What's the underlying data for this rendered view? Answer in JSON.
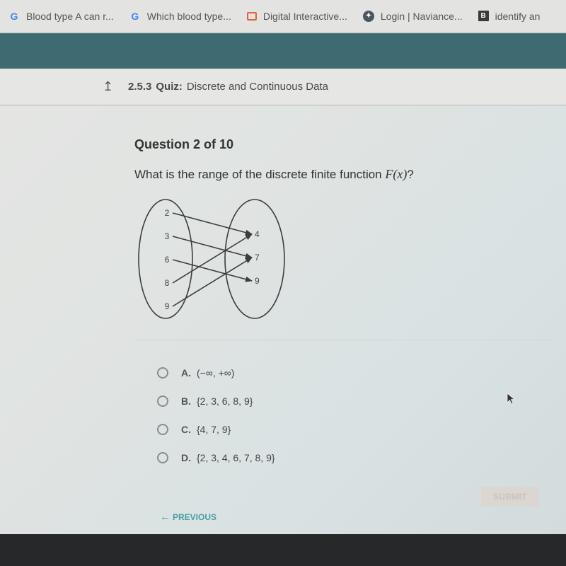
{
  "bookmarks": [
    {
      "icon": "google-icon",
      "glyph": "G",
      "label": "Blood type A can r..."
    },
    {
      "icon": "google-icon",
      "glyph": "G",
      "label": "Which blood type..."
    },
    {
      "icon": "digital-interactive-icon",
      "glyph": "",
      "label": "Digital Interactive..."
    },
    {
      "icon": "naviance-icon",
      "glyph": "✦",
      "label": "Login | Naviance..."
    },
    {
      "icon": "brainly-icon",
      "glyph": "B",
      "label": "identify an"
    }
  ],
  "quiz": {
    "up_icon": "↥",
    "code": "2.5.3",
    "kind": "Quiz:",
    "title": "Discrete and Continuous Data"
  },
  "question": {
    "number": "Question 2 of 10",
    "text_prefix": "What is the range of the discrete finite function ",
    "function": "F(x)",
    "text_suffix": "?"
  },
  "mapping": {
    "domain": [
      "2",
      "3",
      "6",
      "8",
      "9"
    ],
    "range": [
      "4",
      "7",
      "9"
    ],
    "arrows": [
      {
        "from": "2",
        "to": "4"
      },
      {
        "from": "3",
        "to": "7"
      },
      {
        "from": "6",
        "to": "9"
      },
      {
        "from": "8",
        "to": "4"
      },
      {
        "from": "9",
        "to": "7"
      }
    ]
  },
  "options": [
    {
      "letter": "A.",
      "value": "(−∞, +∞)",
      "selected": false
    },
    {
      "letter": "B.",
      "value": "{2, 3, 6, 8, 9}",
      "selected": false
    },
    {
      "letter": "C.",
      "value": "{4, 7, 9}",
      "selected": false
    },
    {
      "letter": "D.",
      "value": "{2, 3, 4, 6, 7, 8, 9}",
      "selected": false
    }
  ],
  "buttons": {
    "submit": "SUBMIT",
    "previous": "PREVIOUS",
    "previous_arrow": "←"
  }
}
